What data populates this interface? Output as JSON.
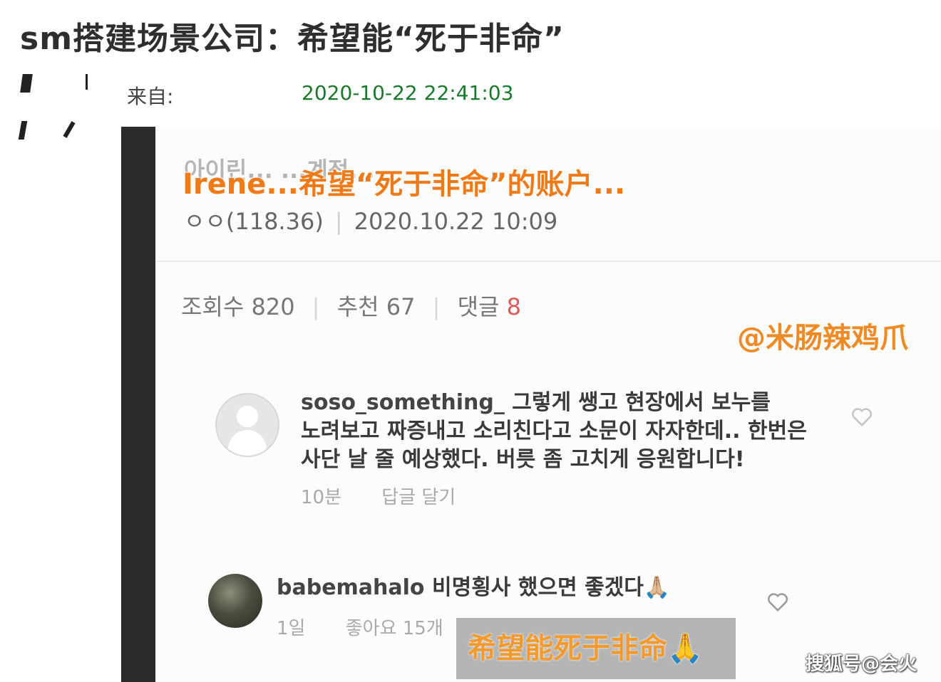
{
  "headline": "sm搭建场景公司：希望能“死于非命”",
  "meta": {
    "from_label": "来自:",
    "date": "2020-10-22 22:41:03"
  },
  "post": {
    "korean_title_partial": "아이린...  ...계정...",
    "overlay_title": "Irene...希望“死于非命”的账户...",
    "author": "ㅇㅇ(118.36)",
    "timestamp": "2020.10.22 10:09",
    "stats": {
      "views_label": "조회수",
      "views": "820",
      "likes_label": "추천",
      "likes": "67",
      "comments_label": "댓글",
      "comments": "8"
    }
  },
  "watermark": "@米肠辣鸡爪",
  "comments": [
    {
      "user": "soso_something_",
      "text_line1": "그렇게 쌩고 현장에서 보누를",
      "text_line2": "노려보고 짜증내고 소리친다고 소문이 자자한데.. 한번은",
      "text_line3": "사단 날 줄 예상했다. 버릇 좀 고치게 응원합니다!",
      "time": "10분",
      "reply": "답글 달기"
    },
    {
      "user": "babemahalo",
      "text": "비명횡사 했으면 좋겠다🙏🏼",
      "time": "1일",
      "likes": "좋아요 15개"
    }
  ],
  "caption": "希望能死于非命🙏",
  "source_badge": "搜狐号@会火",
  "colors": {
    "date_green": "#177a2b",
    "orange": "#f07a18",
    "red_count": "#e05a5a"
  }
}
